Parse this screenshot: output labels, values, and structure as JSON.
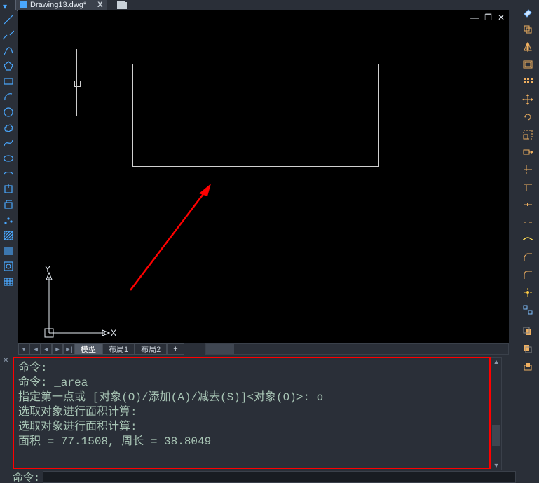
{
  "tabbar": {
    "doc_name": "Drawing13.dwg*",
    "close_x": "X"
  },
  "window_buttons": {
    "min": "—",
    "restore": "❐",
    "close": "✕"
  },
  "left_tools": [
    {
      "name": "line-tool",
      "glyph": "line"
    },
    {
      "name": "xline-tool",
      "glyph": "xline"
    },
    {
      "name": "polyline-tool",
      "glyph": "pline"
    },
    {
      "name": "polygon-tool",
      "glyph": "polygon"
    },
    {
      "name": "rectangle-tool",
      "glyph": "rect"
    },
    {
      "name": "arc-tool",
      "glyph": "arc"
    },
    {
      "name": "circle-tool",
      "glyph": "circle"
    },
    {
      "name": "revcloud-tool",
      "glyph": "cloud"
    },
    {
      "name": "spline-tool",
      "glyph": "spline"
    },
    {
      "name": "ellipse-tool",
      "glyph": "ellipse"
    },
    {
      "name": "ellipse-arc-tool",
      "glyph": "ellarc"
    },
    {
      "name": "insert-block-tool",
      "glyph": "block"
    },
    {
      "name": "make-block-tool",
      "glyph": "mkblock"
    },
    {
      "name": "point-tool",
      "glyph": "point"
    },
    {
      "name": "hatch-tool",
      "glyph": "hatch"
    },
    {
      "name": "gradient-tool",
      "glyph": "grad"
    },
    {
      "name": "region-tool",
      "glyph": "region"
    },
    {
      "name": "table-tool",
      "glyph": "table"
    }
  ],
  "right_tools": [
    {
      "name": "eraser-icon",
      "color": "#6db3ff"
    },
    {
      "name": "copy-icon",
      "color": "#f0b060"
    },
    {
      "name": "mirror-icon",
      "color": "#f0b060"
    },
    {
      "name": "offset-icon",
      "color": "#f0b060"
    },
    {
      "name": "array-icon",
      "color": "#f0b060"
    },
    {
      "name": "move-icon",
      "color": "#f0b060"
    },
    {
      "name": "rotate-icon",
      "color": "#f0b060"
    },
    {
      "name": "scale-icon",
      "color": "#f0b060"
    },
    {
      "name": "stretch-icon",
      "color": "#f0b060"
    },
    {
      "name": "trim-icon",
      "color": "#f0b060"
    },
    {
      "name": "extend-icon",
      "color": "#f0b060"
    },
    {
      "name": "break-at-point-icon",
      "color": "#f0b060"
    },
    {
      "name": "break-icon",
      "color": "#f0b060"
    },
    {
      "name": "join-icon",
      "color": "#f0b060"
    },
    {
      "name": "chamfer-icon",
      "color": "#f0b060"
    },
    {
      "name": "fillet-icon",
      "color": "#f0b060"
    },
    {
      "name": "explode-icon",
      "color": "#f0b060"
    },
    {
      "name": "align-icon",
      "color": "#80c0ff"
    },
    {
      "name": "draworder-front-icon",
      "color": "#f0b060"
    },
    {
      "name": "draworder-back-icon",
      "color": "#f0b060"
    },
    {
      "name": "draworder-above-icon",
      "color": "#f0b060"
    }
  ],
  "ucs": {
    "y": "Y",
    "x": "X"
  },
  "model_tabs": {
    "nav": [
      "◄",
      "|◄",
      "◄",
      "►",
      "►|"
    ],
    "tabs": [
      {
        "label": "模型",
        "active": true
      },
      {
        "label": "布局1",
        "active": false
      },
      {
        "label": "布局2",
        "active": false
      },
      {
        "label": "+",
        "active": false
      }
    ]
  },
  "cmdlog": {
    "l1": "命令:",
    "l2": "命令: _area",
    "l3": "指定第一点或 [对象(O)/添加(A)/减去(S)]<对象(O)>: o",
    "l4": "选取对象进行面积计算:",
    "l5": "选取对象进行面积计算:",
    "l6": "面积 = 77.1508, 周长 = 38.8049"
  },
  "cmdline": {
    "prompt": "命令:",
    "value": ""
  }
}
